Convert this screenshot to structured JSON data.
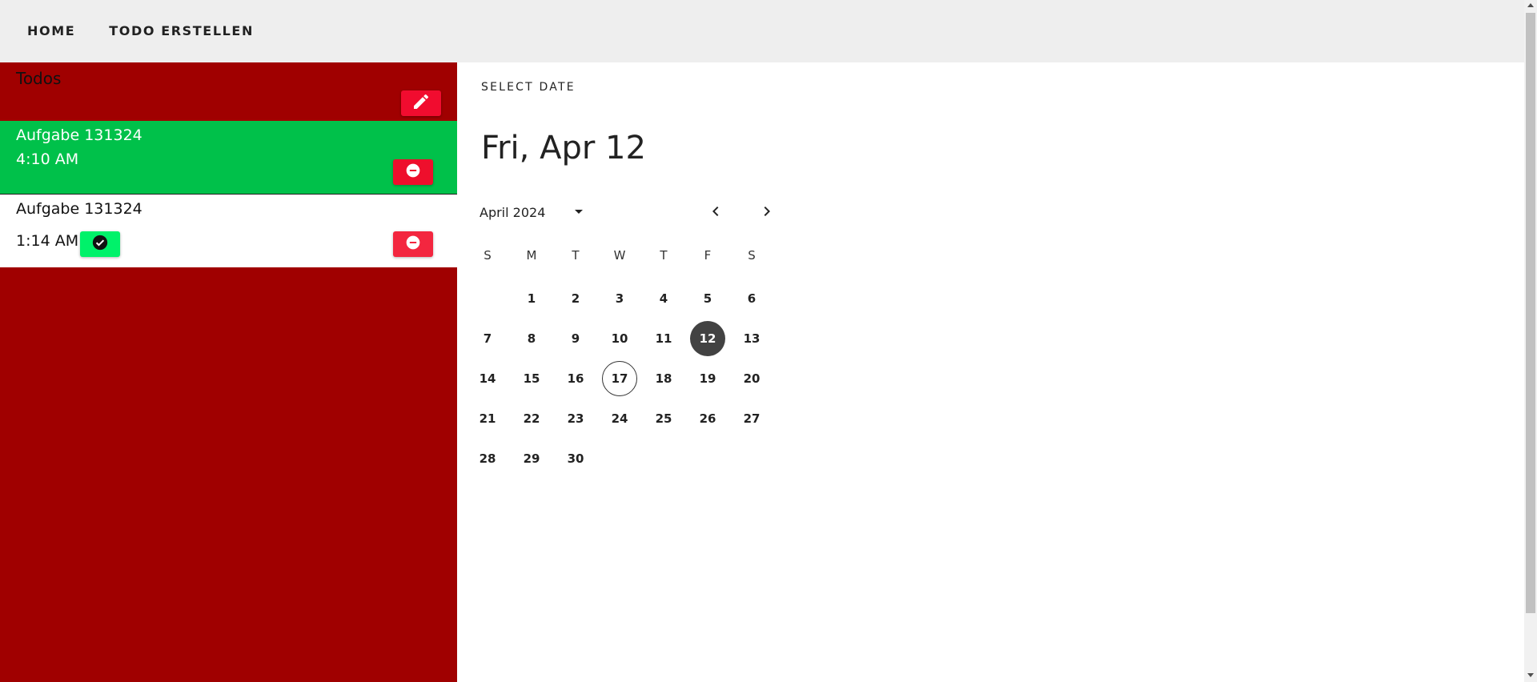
{
  "nav": {
    "home_label": "HOME",
    "create_label": "TODO ERSTELLEN"
  },
  "todos_panel": {
    "title": "Todos",
    "background": "#a00000",
    "edit_icon": "pencil-icon",
    "items": [
      {
        "title": "Aufgabe 131324",
        "time": "4:10 AM",
        "done": true,
        "delete_icon": "minus-circle-icon"
      },
      {
        "title": "Aufgabe 131324",
        "time": "1:14 AM",
        "done": false,
        "done_icon": "check-circle-icon",
        "delete_icon": "minus-circle-icon"
      }
    ]
  },
  "date_picker": {
    "label": "SELECT DATE",
    "selected_display": "Fri, Apr 12",
    "month_label": "April 2024",
    "weekdays": [
      "S",
      "M",
      "T",
      "W",
      "T",
      "F",
      "S"
    ],
    "first_weekday_index": 1,
    "days": [
      "1",
      "2",
      "3",
      "4",
      "5",
      "6",
      "7",
      "8",
      "9",
      "10",
      "11",
      "12",
      "13",
      "14",
      "15",
      "16",
      "17",
      "18",
      "19",
      "20",
      "21",
      "22",
      "23",
      "24",
      "25",
      "26",
      "27",
      "28",
      "29",
      "30"
    ],
    "selected_day": "12",
    "today_day": "17"
  },
  "colors": {
    "accent_red": "#f10c2f",
    "done_green": "#00c14a",
    "check_green": "#00f26a",
    "selected_day": "#424242"
  }
}
